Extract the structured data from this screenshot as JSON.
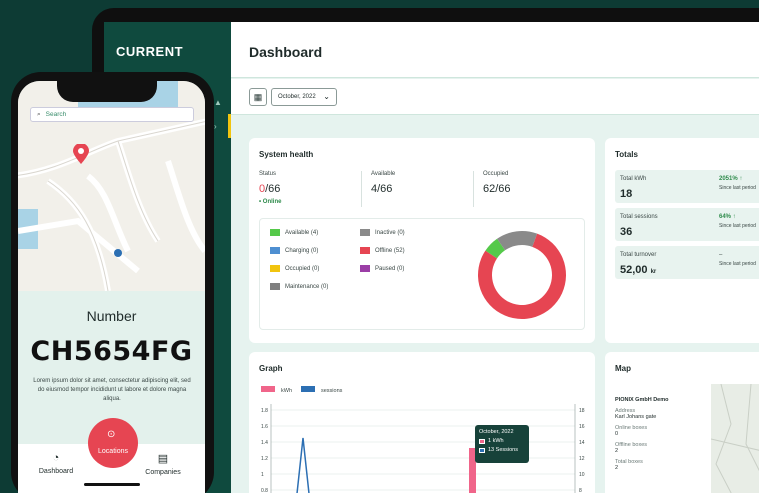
{
  "app": {
    "logo": "CURRENT"
  },
  "header": {
    "title": "Dashboard"
  },
  "filters": {
    "date": "October, 2022"
  },
  "system_health": {
    "title": "System health",
    "status_label": "Status",
    "status_red": "0",
    "status_rest": "/66",
    "status_sub": "Online",
    "available_label": "Available",
    "available_value": "4/66",
    "occupied_label": "Occupied",
    "occupied_value": "62/66",
    "legend": [
      {
        "label": "Available (4)",
        "color": "#55c94a"
      },
      {
        "label": "Charging (0)",
        "color": "#4e8fd1"
      },
      {
        "label": "Occupied (0)",
        "color": "#f1c40f"
      },
      {
        "label": "Maintenance (0)",
        "color": "#7f7f7f"
      },
      {
        "label": "Inactive (0)",
        "color": "#8a8a8a"
      },
      {
        "label": "Offline (52)",
        "color": "#e64552"
      },
      {
        "label": "Paused (0)",
        "color": "#9b3ea6"
      }
    ],
    "donut": [
      {
        "label": "Offline",
        "value": 52,
        "color": "#e64552"
      },
      {
        "label": "Available",
        "value": 4,
        "color": "#55c94a"
      },
      {
        "label": "Inactive",
        "value": 10,
        "color": "#8a8a8a"
      }
    ]
  },
  "totals": {
    "title": "Totals",
    "rows": [
      {
        "label": "Total kWh",
        "value": "18",
        "unit": "",
        "pct": "2051% ↑",
        "since": "Since last period"
      },
      {
        "label": "Total sessions",
        "value": "36",
        "unit": "",
        "pct": "64% ↑",
        "since": "Since last period"
      },
      {
        "label": "Total turnover",
        "value": "52,00",
        "unit": "kr",
        "pct": "–",
        "since": "Since last period"
      }
    ]
  },
  "graph": {
    "title": "Graph",
    "legend_kwh": "kWh",
    "legend_sessions": "sessions",
    "tooltip_title": "October, 2022",
    "tooltip_kwh": "1 kWh",
    "tooltip_sessions": "13 Sessions",
    "colors": {
      "kwh": "#f0658a",
      "sessions": "#2c6fb3"
    }
  },
  "chart_data": {
    "type": "bar",
    "y_left_ticks": [
      "1.8",
      "1.6",
      "1.4",
      "1.2",
      "1",
      "0.8"
    ],
    "y_right_ticks": [
      "18",
      "16",
      "14",
      "12",
      "10",
      "8"
    ]
  },
  "map_card": {
    "title": "Map",
    "name": "PIONIX GmbH Demo",
    "address_label": "Address",
    "address": "Karl Johans gate",
    "online_label": "Online boxes",
    "online": "0",
    "offline_label": "Offline boxes",
    "offline": "2",
    "total_label": "Total boxes",
    "total": "2"
  },
  "phone": {
    "search_placeholder": "Search",
    "number_label": "Number",
    "number": "CH5654FG",
    "lorem": "Lorem ipsum dolor sit amet, consectetur adipiscing elit, sed do eiusmod tempor incididunt ut labore et dolore magna aliqua.",
    "tab_dashboard": "Dashboard",
    "tab_locations": "Locations",
    "tab_companies": "Companies"
  }
}
